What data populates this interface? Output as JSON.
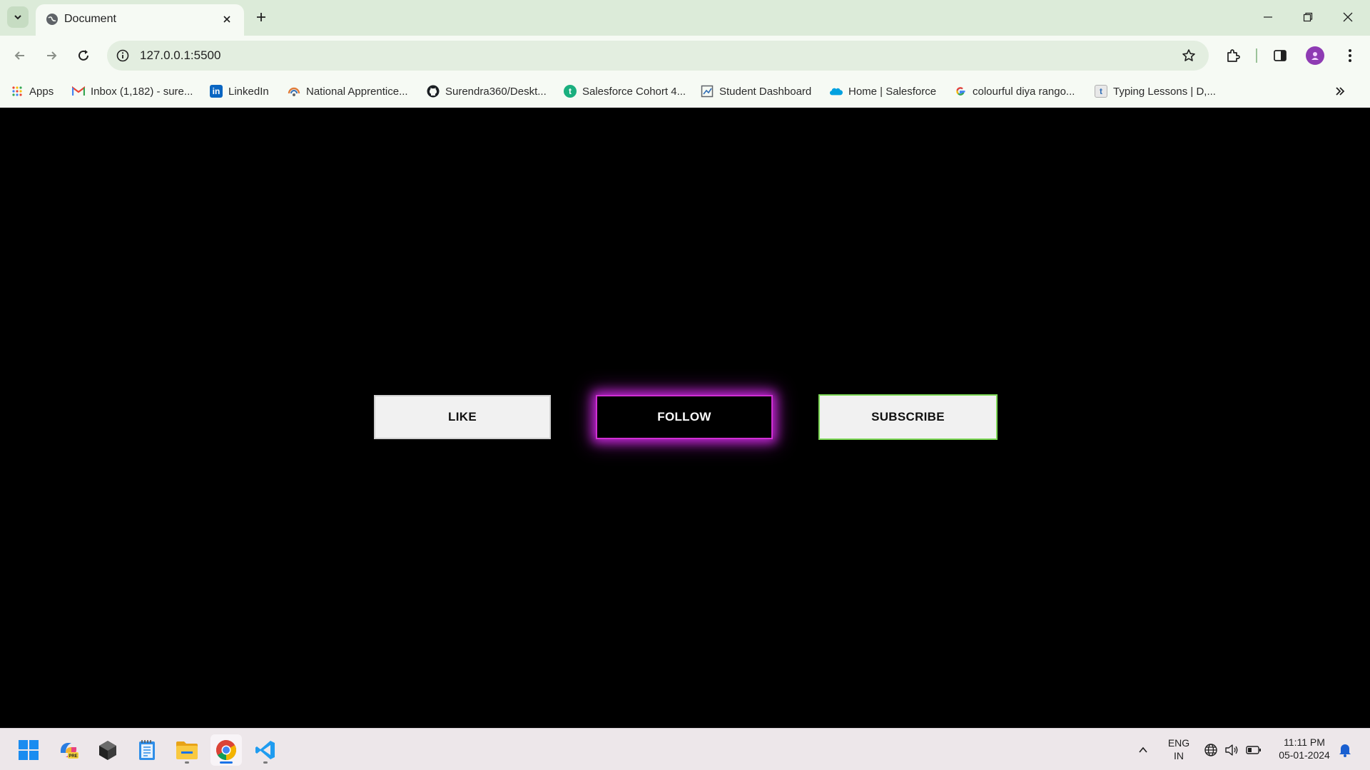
{
  "browser": {
    "tab": {
      "title": "Document"
    },
    "address": {
      "url": "127.0.0.1:5500"
    },
    "bookmarks": [
      {
        "label": "Apps",
        "icon": "apps-grid-icon"
      },
      {
        "label": "Inbox (1,182) - sure...",
        "icon": "gmail-icon"
      },
      {
        "label": "LinkedIn",
        "icon": "linkedin-icon"
      },
      {
        "label": "National Apprentice...",
        "icon": "apprentice-icon"
      },
      {
        "label": "Surendra360/Deskt...",
        "icon": "github-icon"
      },
      {
        "label": "Salesforce Cohort 4...",
        "icon": "cohort-icon"
      },
      {
        "label": "Student Dashboard",
        "icon": "dashboard-icon"
      },
      {
        "label": "Home | Salesforce",
        "icon": "salesforce-cloud-icon"
      },
      {
        "label": "colourful diya rango...",
        "icon": "google-icon"
      },
      {
        "label": "Typing Lessons | D,...",
        "icon": "typing-icon"
      }
    ]
  },
  "page": {
    "buttons": {
      "like": "LIKE",
      "follow": "FOLLOW",
      "subscribe": "SUBSCRIBE"
    },
    "colors": {
      "background": "#000000",
      "follow_glow": "#c026d3",
      "subscribe_border": "#7ed957"
    }
  },
  "taskbar": {
    "language": {
      "line1": "ENG",
      "line2": "IN"
    },
    "clock": {
      "time": "11:11 PM",
      "date": "05-01-2024"
    }
  }
}
